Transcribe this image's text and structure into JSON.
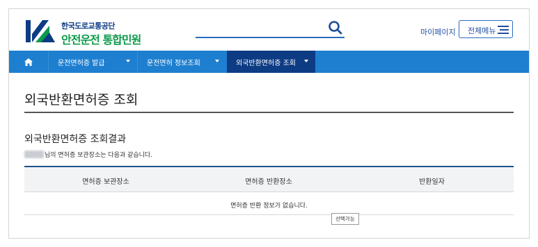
{
  "header": {
    "brand_top": "한국도로교통공단",
    "brand_main": "안전운전 통합민원",
    "mypage_label": "마이페이지",
    "menu_label": "전체메뉴"
  },
  "nav": {
    "items": [
      {
        "label": "운전면허증 발급"
      },
      {
        "label": "운전면허 정보조회"
      },
      {
        "label": "외국반환면허증 조회"
      }
    ]
  },
  "main": {
    "page_title": "외국반환면허증 조회",
    "section_title": "외국반환면허증 조회결과",
    "description": "님의 면허증 보관장소는 다음과 같습니다.",
    "table": {
      "headers": [
        "면허증 보관장소",
        "면허증 반환장소",
        "반환일자"
      ],
      "empty_message": "면허증 반환 정보가 없습니다."
    },
    "tooltip": "선택가능"
  },
  "colors": {
    "nav_bg": "#1e7fd0",
    "nav_active": "#0d3c84",
    "brand_blue": "#0d3c84",
    "brand_green": "#0d9a4a"
  }
}
